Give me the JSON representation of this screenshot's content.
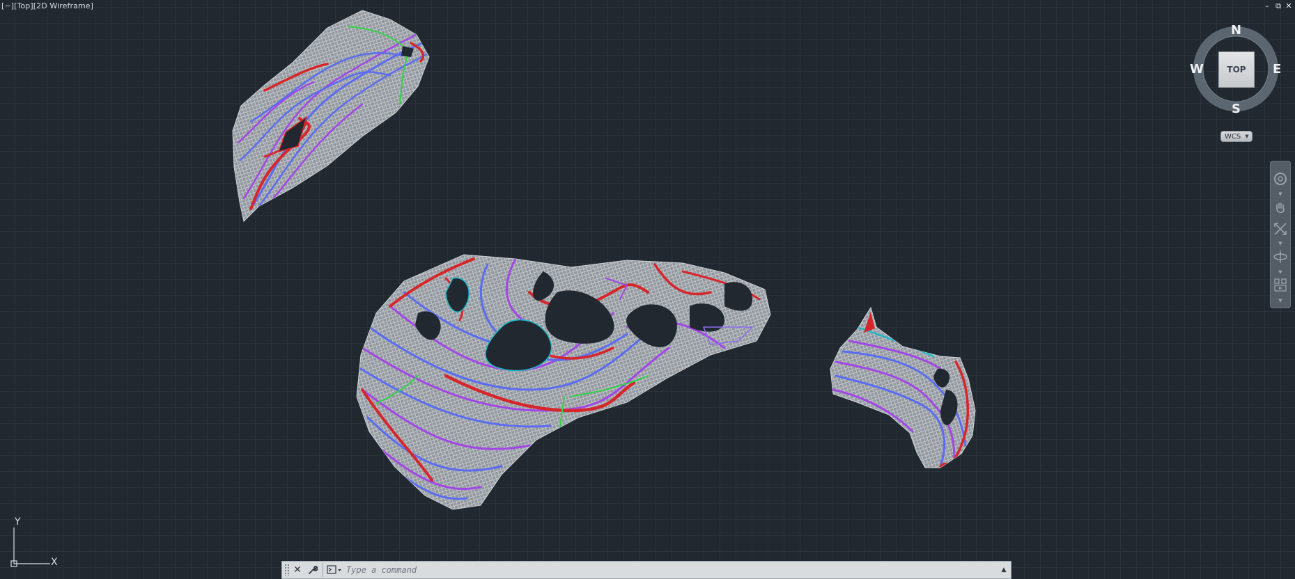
{
  "viewport": {
    "label": "[−][Top][2D Wireframe]",
    "window_controls": {
      "minimize": "–",
      "restore": "⧉",
      "close": "✕"
    },
    "background_color": "#212830",
    "grid_color": "#2b333d"
  },
  "viewcube": {
    "north": "N",
    "south": "S",
    "east": "E",
    "west": "W",
    "face": "TOP",
    "ucs_menu": "WCS"
  },
  "navbar": {
    "items": [
      "steering-wheel",
      "pan",
      "zoom-extents",
      "orbit",
      "showmotion"
    ]
  },
  "ucs": {
    "x_label": "X",
    "y_label": "Y"
  },
  "command_line": {
    "placeholder": "Type a command",
    "value": ""
  },
  "drawing": {
    "colors": {
      "mesh": "#b8bcc0",
      "contour_red": "#d7262b",
      "contour_blue": "#5b6cf0",
      "contour_purple": "#a247e6",
      "contour_cyan": "#1fb8c8",
      "breakline_green": "#33d24a"
    }
  }
}
